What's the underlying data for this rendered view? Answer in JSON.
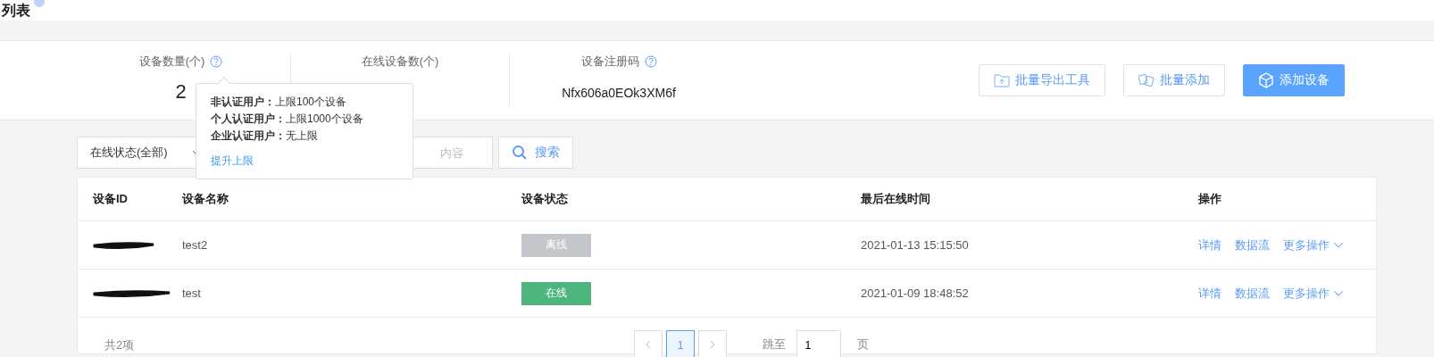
{
  "header": {
    "title": "列表"
  },
  "stats": [
    {
      "label": "设备数量(个)",
      "value": "2",
      "help": true
    },
    {
      "label": "在线设备数(个)",
      "help": false
    },
    {
      "label": "设备注册码",
      "value": "Nfx606a0EOk3XM6f",
      "help": true
    }
  ],
  "actions": [
    {
      "label": "批量导出工具",
      "kind": "export",
      "primary": false
    },
    {
      "label": "批量添加",
      "kind": "batch",
      "primary": false
    },
    {
      "label": "添加设备",
      "kind": "add",
      "primary": true
    }
  ],
  "tooltip": {
    "lines": [
      "**非认证用户：**上限100个设备",
      "**个人认证用户：**上限1000个设备",
      "**企业认证用户：**无上限"
    ],
    "link": "提升上限"
  },
  "filter": {
    "status_select": "在线状态(全部)",
    "search_placeholder": "内容",
    "search_button": "搜索"
  },
  "table": {
    "columns": [
      "设备ID",
      "设备名称",
      "设备状态",
      "最后在线时间",
      "操作"
    ],
    "rows": [
      {
        "name": "test2",
        "status": "离线",
        "online": false,
        "last_online": "2021-01-13 15:15:50",
        "actions": [
          "详情",
          "数据流",
          "更多操作"
        ]
      },
      {
        "name": "test",
        "status": "在线",
        "online": true,
        "last_online": "2021-01-09 18:48:52",
        "actions": [
          "详情",
          "数据流",
          "更多操作"
        ]
      }
    ]
  },
  "pagination": {
    "total": "共2项",
    "pages": [
      {
        "label": "1",
        "selected": true
      }
    ],
    "jump_label": "跳至",
    "jump_value": "1",
    "page_suffix": "页"
  }
}
